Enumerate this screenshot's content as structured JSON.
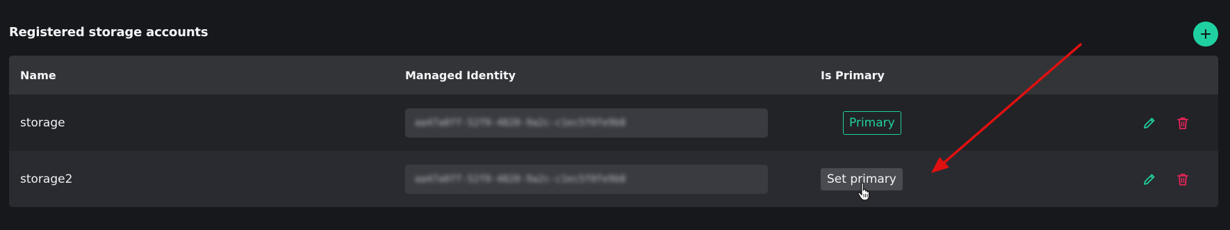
{
  "colors": {
    "accent": "#1fd1a0",
    "danger": "#e8245a",
    "arrow": "#e01010"
  },
  "section": {
    "title": "Registered storage accounts",
    "add_button_icon": "plus-icon"
  },
  "table": {
    "columns": [
      "Name",
      "Managed Identity",
      "Is Primary"
    ],
    "rows": [
      {
        "name": "storage",
        "identity": "aa47a0ff-52f0-4820-9a2c-c1ec5f0fe9b8",
        "primary_label": "Primary",
        "is_primary": true,
        "edit_icon": "pencil-icon",
        "delete_icon": "trash-icon"
      },
      {
        "name": "storage2",
        "identity": "aa47a0ff-52f0-4820-9a2c-c1ec5f0fe9b8",
        "primary_label": "Set primary",
        "is_primary": false,
        "edit_icon": "pencil-icon",
        "delete_icon": "trash-icon"
      }
    ]
  },
  "annotations": {
    "arrow_icon": "red-arrow-annotation",
    "cursor_icon": "hand-pointer-cursor"
  }
}
